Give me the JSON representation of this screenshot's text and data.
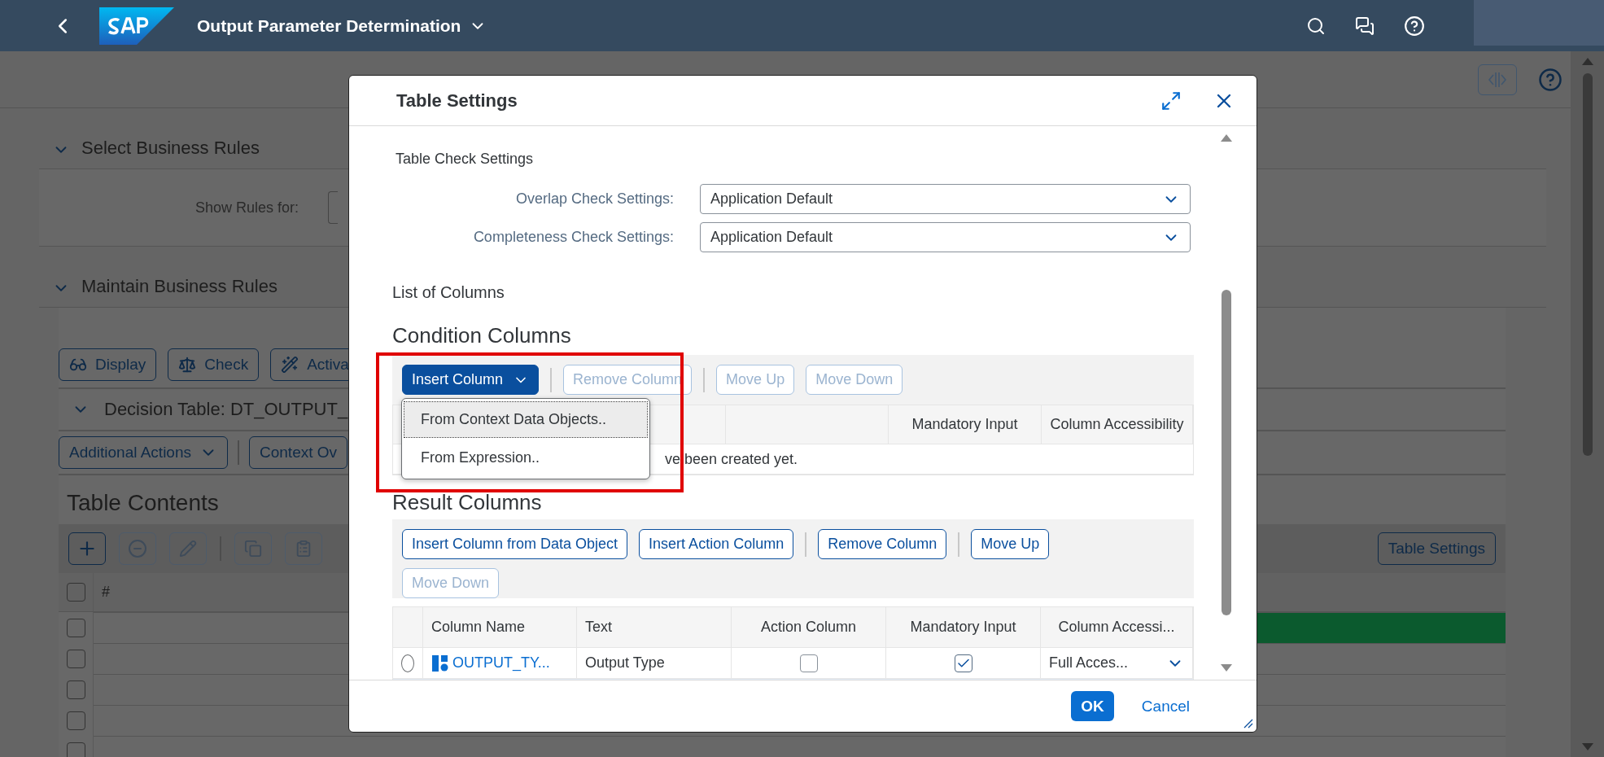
{
  "shell": {
    "title": "Output Parameter Determination"
  },
  "page": {
    "select_section": {
      "title": "Select Business Rules",
      "field_label": "Show Rules for:"
    },
    "maintain_section": {
      "title": "Maintain Business Rules",
      "buttons": [
        "Display",
        "Check",
        "Activa"
      ],
      "decision_table": {
        "title": "Decision Table: DT_OUTPUT_",
        "buttons": [
          {
            "label": "Additional Actions",
            "kind": "menu"
          },
          {
            "label": "Context Ov",
            "kind": "button"
          }
        ]
      },
      "table_contents": {
        "title": "Table Contents",
        "settings_button": "Table Settings",
        "header": "#",
        "select_all_checked": false,
        "rows": [
          {
            "selected": true,
            "checked": false
          },
          {
            "selected": false,
            "checked": false
          },
          {
            "selected": false,
            "checked": false
          },
          {
            "selected": false,
            "checked": false
          },
          {
            "selected": false,
            "checked": false
          }
        ]
      }
    }
  },
  "dialog": {
    "title": "Table Settings",
    "check_settings": {
      "title": "Table Check Settings",
      "fields": [
        {
          "label": "Overlap Check Settings:",
          "value": "Application Default"
        },
        {
          "label": "Completeness Check Settings:",
          "value": "Application Default"
        }
      ]
    },
    "columns_title": "List of Columns",
    "condition_columns": {
      "title": "Condition Columns",
      "toolbar": [
        {
          "label": "Insert Column",
          "kind": "menu",
          "disabled": false
        },
        {
          "label": "Remove Column",
          "kind": "button",
          "disabled": true
        },
        {
          "label": "Move Up",
          "kind": "button",
          "disabled": true
        },
        {
          "label": "Move Down",
          "kind": "button",
          "disabled": true
        }
      ],
      "menu": [
        {
          "label": "From Context Data Objects..",
          "selected": true
        },
        {
          "label": "From Expression..",
          "selected": false
        }
      ],
      "columns": [
        "Mandatory Input",
        "Column Accessibility"
      ],
      "no_data": "ve been created yet."
    },
    "result_columns": {
      "title": "Result Columns",
      "toolbar": [
        {
          "label": "Insert Column from Data Object",
          "kind": "button",
          "disabled": false
        },
        {
          "label": "Insert Action Column",
          "kind": "button",
          "disabled": false
        },
        {
          "label": "Remove Column",
          "kind": "button",
          "disabled": false
        },
        {
          "label": "Move Up",
          "kind": "button",
          "disabled": false
        },
        {
          "label": "Move Down",
          "kind": "button",
          "disabled": true
        }
      ],
      "columns": [
        "Column Name",
        "Text",
        "Action Column",
        "Mandatory Input",
        "Column Accessi..."
      ],
      "rows": [
        {
          "selected": false,
          "name": "OUTPUT_TY...",
          "text": "Output Type",
          "action_column": false,
          "mandatory_input": true,
          "accessibility": "Full Acces..."
        }
      ]
    },
    "buttons": [
      {
        "label": "OK",
        "kind": "primary"
      },
      {
        "label": "Cancel",
        "kind": "plain"
      }
    ]
  }
}
